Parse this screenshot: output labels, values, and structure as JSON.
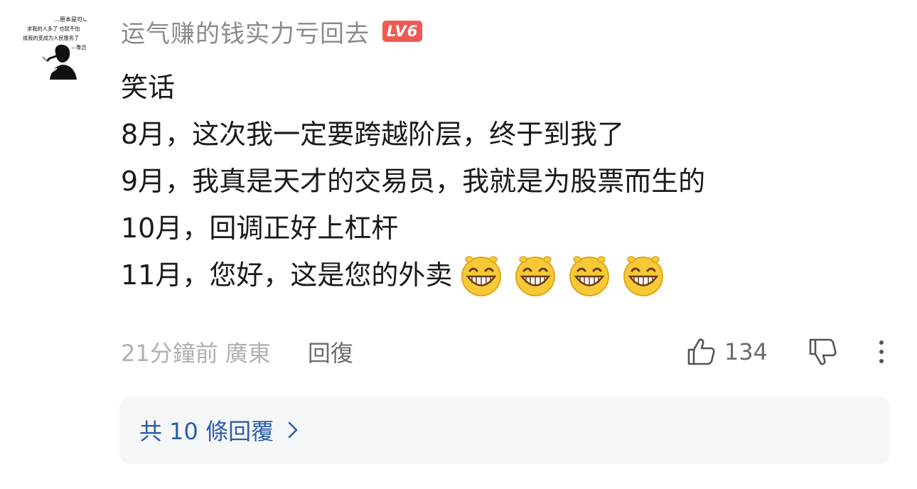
{
  "user": {
    "avatar_lines": [
      "…原本是可以…",
      "求我的人多了 也就不怕",
      "成我的变成为人民服务了",
      "—鲁迅"
    ],
    "name": "运气赚的钱实力亏回去",
    "level": "LV6"
  },
  "comment": {
    "lines": [
      "笑话",
      "8月，这次我一定要跨越阶层，终于到我了",
      "9月，我真是天才的交易员，我就是为股票而生的",
      "10月，回调正好上杠杆",
      "11月，您好，这是您的外卖"
    ],
    "emojis": [
      "grinning-face-icon",
      "grinning-face-icon",
      "grinning-face-icon",
      "grinning-face-icon"
    ]
  },
  "meta": {
    "time_location": "21分鐘前 廣東",
    "reply_label": "回復",
    "like_count": "134"
  },
  "replies": {
    "label": "共 10 條回覆"
  },
  "colors": {
    "badge": "#f05a51",
    "link": "#2a5da8",
    "muted": "#b0b0b0"
  }
}
